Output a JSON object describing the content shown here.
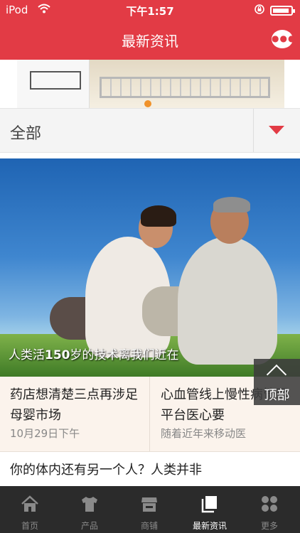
{
  "status_bar": {
    "carrier": "iPod",
    "time": "下午1:57"
  },
  "nav": {
    "title": "最新资讯"
  },
  "filter": {
    "label": "全部"
  },
  "hero": {
    "caption_part1": "人类活",
    "caption_num": "150",
    "caption_part2": "岁的技术离我们近在"
  },
  "top_button": {
    "label": "顶部"
  },
  "news_grid": [
    {
      "title": "药店想清楚三点再涉足母婴市场",
      "subtitle": "10月29日下午"
    },
    {
      "title": "心血管线上慢性病管理平台医心要",
      "subtitle": "随着近年来移动医"
    }
  ],
  "news_row": {
    "title": "你的体内还有另一个人？人类并非"
  },
  "tabs": [
    {
      "label": "首页",
      "icon": "home-icon"
    },
    {
      "label": "产品",
      "icon": "shirt-icon"
    },
    {
      "label": "商铺",
      "icon": "shop-icon"
    },
    {
      "label": "最新资讯",
      "icon": "news-icon",
      "active": true
    },
    {
      "label": "更多",
      "icon": "more-icon"
    }
  ],
  "colors": {
    "brand": "#e23b45",
    "tab_bar": "#2b2b2b"
  }
}
